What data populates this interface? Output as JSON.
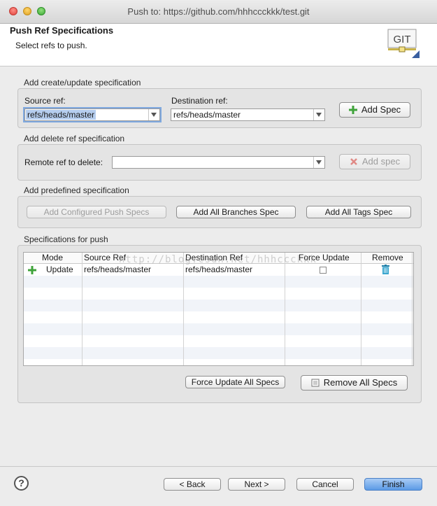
{
  "window": {
    "title": "Push to: https://github.com/hhhccckkk/test.git"
  },
  "header": {
    "title": "Push Ref Specifications",
    "subtitle": "Select refs to push.",
    "logo_text": "GIT"
  },
  "create_update": {
    "group_label": "Add create/update specification",
    "source_label": "Source ref:",
    "source_value": "refs/heads/master",
    "dest_label": "Destination ref:",
    "dest_value": "refs/heads/master",
    "add_button": "Add Spec"
  },
  "delete": {
    "group_label": "Add delete ref specification",
    "remote_label": "Remote ref to delete:",
    "remote_value": "",
    "add_button": "Add spec"
  },
  "predefined": {
    "group_label": "Add predefined specification",
    "configured_button": "Add Configured Push Specs",
    "branches_button": "Add All Branches Spec",
    "tags_button": "Add All Tags Spec"
  },
  "specs": {
    "group_label": "Specifications for push",
    "columns": [
      "Mode",
      "Source Ref",
      "Destination Ref",
      "Force Update",
      "Remove"
    ],
    "rows": [
      {
        "mode": "Update",
        "source": "refs/heads/master",
        "destination": "refs/heads/master",
        "force": false
      }
    ],
    "force_all_button": "Force Update All Specs",
    "remove_all_button": "Remove All Specs"
  },
  "footer": {
    "help_label": "?",
    "back_button": "< Back",
    "next_button": "Next >",
    "cancel_button": "Cancel",
    "finish_button": "Finish"
  },
  "watermark": "http://blog.csdn.net/hhhccckkk",
  "colors": {
    "primary_button": "#5b9ae6",
    "selection": "#b5cdee",
    "add_icon": "#3fa33a",
    "remove_icon": "#2b8fb3",
    "disabled_icon": "#d9534f"
  }
}
